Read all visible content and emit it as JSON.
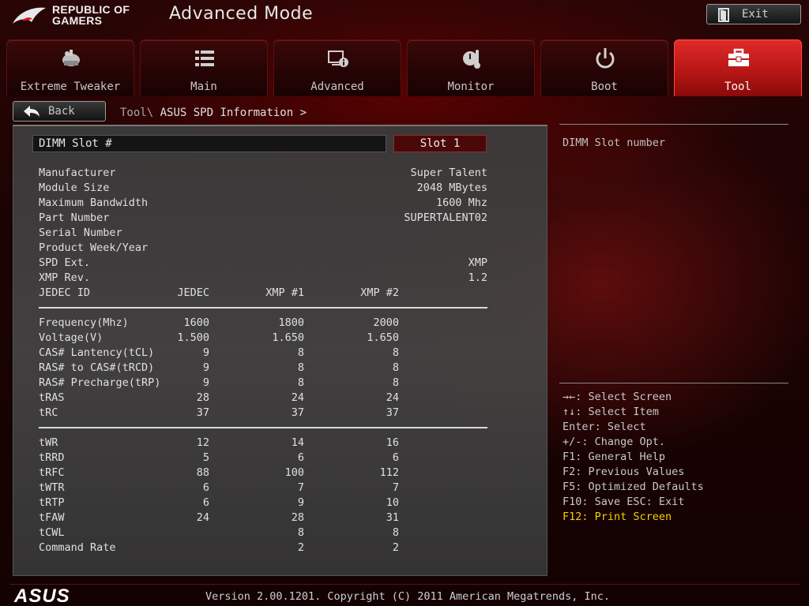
{
  "header": {
    "logo_line1": "REPUBLIC OF",
    "logo_line2": "GAMERS",
    "mode_title": "Advanced Mode",
    "exit_label": "Exit"
  },
  "tabs": [
    {
      "label": "Extreme Tweaker",
      "icon": "tweaker-icon",
      "active": false
    },
    {
      "label": "Main",
      "icon": "list-icon",
      "active": false
    },
    {
      "label": "Advanced",
      "icon": "advanced-icon",
      "active": false
    },
    {
      "label": "Monitor",
      "icon": "monitor-icon",
      "active": false
    },
    {
      "label": "Boot",
      "icon": "power-icon",
      "active": false
    },
    {
      "label": "Tool",
      "icon": "toolbox-icon",
      "active": true
    }
  ],
  "nav": {
    "back_label": "Back",
    "breadcrumb_path": "Tool\\",
    "breadcrumb_current": " ASUS SPD Information >"
  },
  "dimm": {
    "label": "DIMM Slot #",
    "value": "Slot 1"
  },
  "info": [
    {
      "label": "Manufacturer",
      "value": "Super Talent"
    },
    {
      "label": "Module Size",
      "value": "2048 MBytes"
    },
    {
      "label": "Maximum Bandwidth",
      "value": "1600 Mhz"
    },
    {
      "label": "Part Number",
      "value": "SUPERTALENT02"
    },
    {
      "label": "Serial Number",
      "value": ""
    },
    {
      "label": "Product Week/Year",
      "value": ""
    },
    {
      "label": "SPD Ext.",
      "value": "XMP"
    },
    {
      "label": "XMP Rev.",
      "value": "1.2"
    }
  ],
  "timing_header": {
    "label": "JEDEC ID",
    "c1": "JEDEC",
    "c2": "XMP #1",
    "c3": "XMP #2"
  },
  "timings_a": [
    {
      "label": "Frequency(Mhz)",
      "c1": "1600",
      "c2": "1800",
      "c3": "2000"
    },
    {
      "label": "Voltage(V)",
      "c1": "1.500",
      "c2": "1.650",
      "c3": "1.650"
    },
    {
      "label": "CAS# Lantency(tCL)",
      "c1": "9",
      "c2": "8",
      "c3": "8"
    },
    {
      "label": "RAS# to CAS#(tRCD)",
      "c1": "9",
      "c2": "8",
      "c3": "8"
    },
    {
      "label": "RAS# Precharge(tRP)",
      "c1": "9",
      "c2": "8",
      "c3": "8"
    },
    {
      "label": "tRAS",
      "c1": "28",
      "c2": "24",
      "c3": "24"
    },
    {
      "label": "tRC",
      "c1": "37",
      "c2": "37",
      "c3": "37"
    }
  ],
  "timings_b": [
    {
      "label": "tWR",
      "c1": "12",
      "c2": "14",
      "c3": "16"
    },
    {
      "label": "tRRD",
      "c1": "5",
      "c2": "6",
      "c3": "6"
    },
    {
      "label": "tRFC",
      "c1": "88",
      "c2": "100",
      "c3": "112"
    },
    {
      "label": "tWTR",
      "c1": "6",
      "c2": "7",
      "c3": "7"
    },
    {
      "label": "tRTP",
      "c1": "6",
      "c2": "9",
      "c3": "10"
    },
    {
      "label": "tFAW",
      "c1": "24",
      "c2": "28",
      "c3": "31"
    },
    {
      "label": "tCWL",
      "c1": "",
      "c2": "8",
      "c3": "8"
    },
    {
      "label": "Command Rate",
      "c1": "",
      "c2": "2",
      "c3": "2"
    }
  ],
  "help": {
    "description": "DIMM Slot number"
  },
  "keys": [
    {
      "text": "→←: Select Screen",
      "highlight": false
    },
    {
      "text": "↑↓: Select Item",
      "highlight": false
    },
    {
      "text": "Enter: Select",
      "highlight": false
    },
    {
      "text": "+/-: Change Opt.",
      "highlight": false
    },
    {
      "text": "F1: General Help",
      "highlight": false
    },
    {
      "text": "F2: Previous Values",
      "highlight": false
    },
    {
      "text": "F5: Optimized Defaults",
      "highlight": false
    },
    {
      "text": "F10: Save  ESC: Exit",
      "highlight": false
    },
    {
      "text": "F12: Print Screen",
      "highlight": true
    }
  ],
  "footer": {
    "brand": "ASUS",
    "version": "Version 2.00.1201. Copyright (C) 2011 American Megatrends, Inc."
  },
  "colors": {
    "accent_red": "#d42020",
    "highlight_yellow": "#f0d000"
  }
}
